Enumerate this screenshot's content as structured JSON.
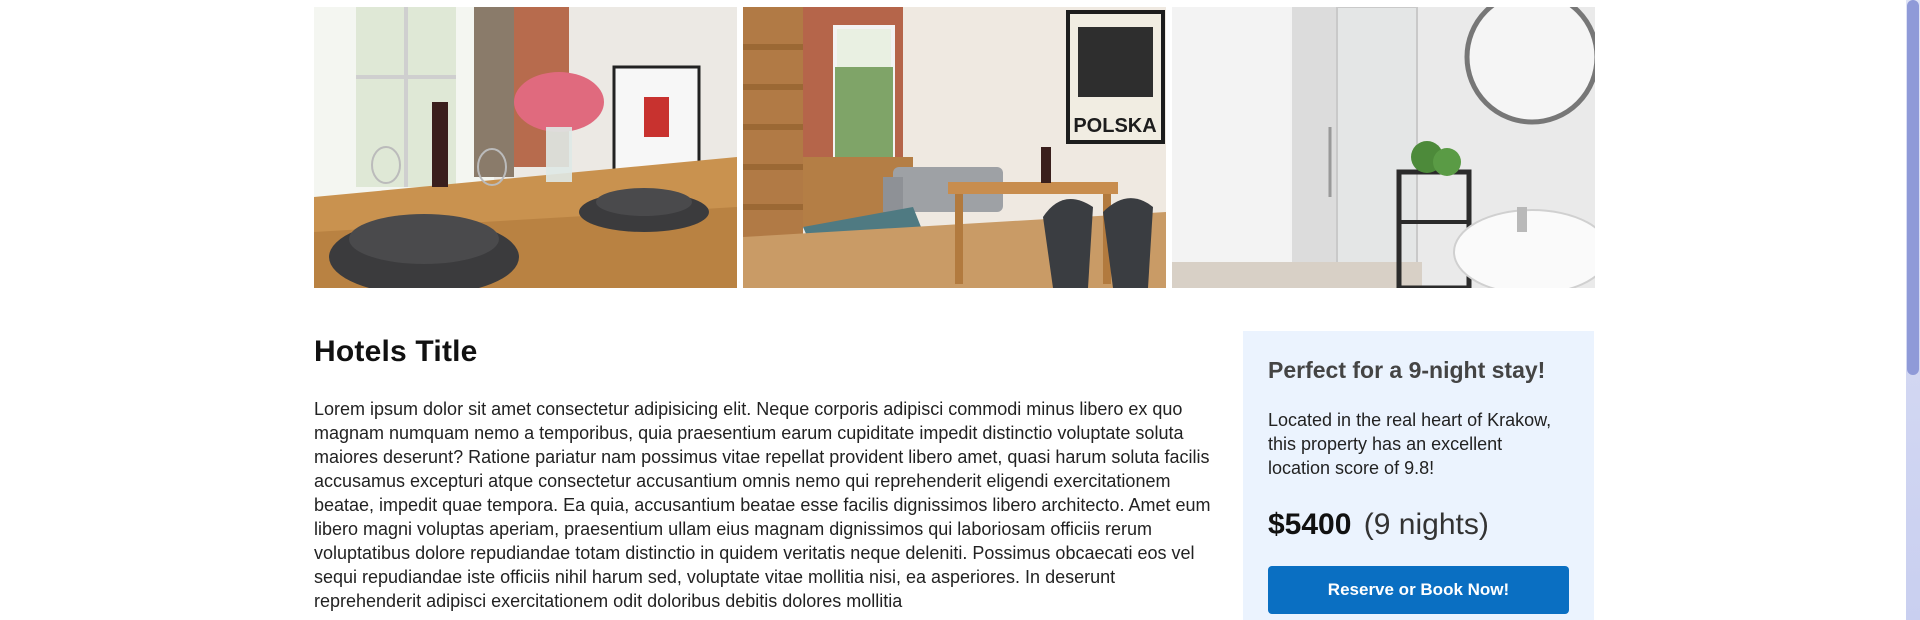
{
  "gallery": {
    "photos": [
      {
        "icon": "dining-table-photo"
      },
      {
        "icon": "living-room-photo",
        "poster_text": "POLSKA"
      },
      {
        "icon": "bathroom-photo"
      }
    ]
  },
  "hotel": {
    "title": "Hotels Title",
    "description": "Lorem ipsum dolor sit amet consectetur adipisicing elit. Neque corporis adipisci commodi minus libero ex quo magnam numquam nemo a temporibus, quia praesentium earum cupiditate impedit distinctio voluptate soluta maiores deserunt? Ratione pariatur nam possimus vitae repellat provident libero amet, quasi harum soluta facilis accusamus excepturi atque consectetur accusantium omnis nemo qui reprehenderit eligendi exercitationem beatae, impedit quae tempora. Ea quia, accusantium beatae esse facilis dignissimos libero architecto. Amet eum libero magni voluptas aperiam, praesentium ullam eius magnam dignissimos qui laboriosam officiis rerum voluptatibus dolore repudiandae totam distinctio in quidem veritatis neque deleniti. Possimus obcaecati eos vel sequi repudiandae iste officiis nihil harum sed, voluptate vitae mollitia nisi, ea asperiores. In deserunt reprehenderit adipisci exercitationem odit doloribus debitis dolores mollitia"
  },
  "booking": {
    "heading": "Perfect for a 9-night stay!",
    "text": "Located in the real heart of Krakow, this property has an excellent location score of 9.8!",
    "price": "$5400",
    "nights": "(9 nights)",
    "button_label": "Reserve or Book Now!"
  },
  "colors": {
    "card_background": "#ebf3fe",
    "button": "#0a6fc2",
    "scrollbar_thumb": "#8f9ad8"
  }
}
